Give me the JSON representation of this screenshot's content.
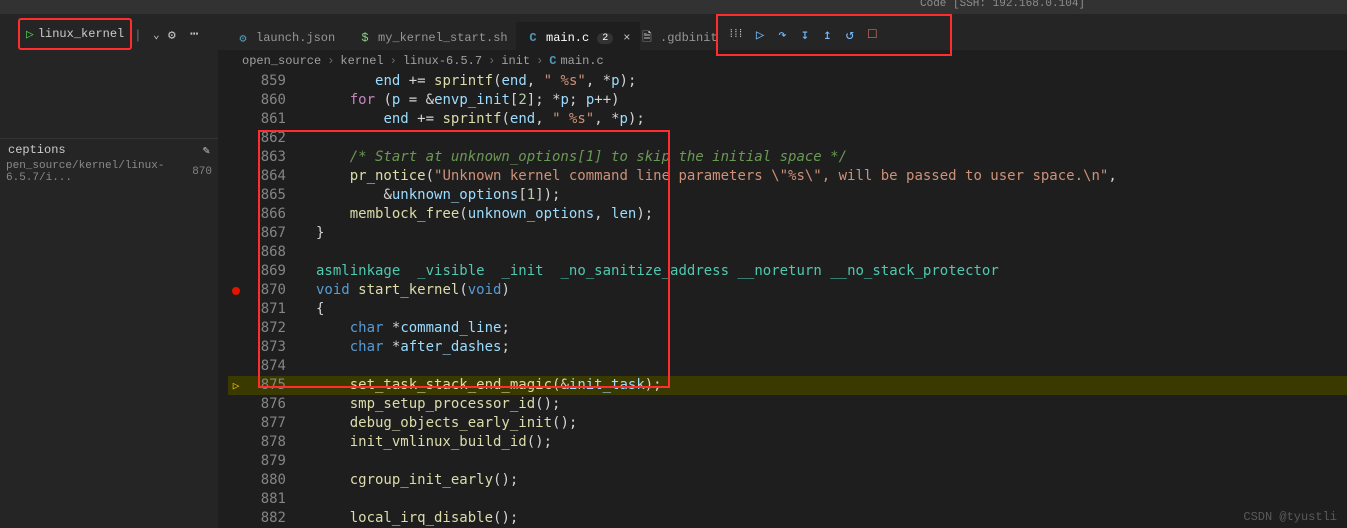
{
  "ssh_hint": "Code [SSH: 192.168.0.104]",
  "toolbar": {
    "config_name": "linux_kernel",
    "tabs": {
      "launch": "launch.json",
      "kern": "my_kernel_start.sh",
      "main": "main.c",
      "main_badge": "2",
      "gdb": ".gdbinit"
    }
  },
  "debug_icons": {
    "grip": "⁞⁞⁞",
    "cont": "▷",
    "over": "↷",
    "into": "↧",
    "out": "↥",
    "restart": "↺",
    "stop": "□"
  },
  "leftpanel": {
    "exceptions": "ceptions",
    "file": "pen_source/kernel/linux-6.5.7/i...",
    "file_line": "870"
  },
  "breadcrumbs": [
    "open_source",
    "kernel",
    "linux-6.5.7",
    "init",
    "main.c"
  ],
  "crumb_icon": "C",
  "lines": [
    {
      "n": "859",
      "g": "",
      "html": "       <span class='var'>end</span> <span class='op'>+=</span> <span class='fn'>sprintf</span>(<span class='var'>end</span>, <span class='str'>\" %s\"</span>, <span class='op'>*</span><span class='var'>p</span>);"
    },
    {
      "n": "860",
      "g": "",
      "html": "    <span class='kw2'>for</span> (<span class='var'>p</span> <span class='op'>=</span> <span class='op'>&amp;</span><span class='var'>envp_init</span>[<span class='num'>2</span>]; <span class='op'>*</span><span class='var'>p</span>; <span class='var'>p</span><span class='op'>++</span>)"
    },
    {
      "n": "861",
      "g": "",
      "html": "        <span class='var'>end</span> <span class='op'>+=</span> <span class='fn'>sprintf</span>(<span class='var'>end</span>, <span class='str'>\" %s\"</span>, <span class='op'>*</span><span class='var'>p</span>);"
    },
    {
      "n": "862",
      "g": "",
      "html": ""
    },
    {
      "n": "863",
      "g": "",
      "html": "    <span class='cm'>/* Start at unknown_options[1] to skip the initial space */</span>"
    },
    {
      "n": "864",
      "g": "",
      "html": "    <span class='fn'>pr_notice</span>(<span class='str'>\"Unknown kernel command line parameters \\\"%s\\\", will be passed to user space.\\n\"</span>,"
    },
    {
      "n": "865",
      "g": "",
      "html": "        <span class='op'>&amp;</span><span class='var'>unknown_options</span>[<span class='num'>1</span>]);"
    },
    {
      "n": "866",
      "g": "",
      "html": "    <span class='fn'>memblock_free</span>(<span class='var'>unknown_options</span>, <span class='var'>len</span>);"
    },
    {
      "n": "867",
      "g": "",
      "html": "}"
    },
    {
      "n": "868",
      "g": "",
      "html": ""
    },
    {
      "n": "869",
      "g": "",
      "html": "<span class='mac'>asmlinkage</span>  <span class='mac'>_visible</span>  <span class='mac'>_init</span>  <span class='mac'>_no_sanitize_address</span> <span class='mac'>__noreturn</span> <span class='mac'>__no_stack_protector</span>"
    },
    {
      "n": "870",
      "g": "bp",
      "html": "<span class='kw'>void</span> <span class='fn'>start_kernel</span>(<span class='kw'>void</span>)"
    },
    {
      "n": "871",
      "g": "",
      "html": "<span class='op'>{</span>"
    },
    {
      "n": "872",
      "g": "",
      "html": "    <span class='kw'>char</span> <span class='op'>*</span><span class='var'>command_line</span>;"
    },
    {
      "n": "873",
      "g": "",
      "html": "    <span class='kw'>char</span> <span class='op'>*</span><span class='var'>after_dashes</span>;"
    },
    {
      "n": "874",
      "g": "",
      "html": ""
    },
    {
      "n": "875",
      "g": "arr",
      "cur": true,
      "html": "    <span class='fn'>set_task_stack_end_magic</span>(<span class='op'>&amp;</span><span class='var'>init_task</span>);"
    },
    {
      "n": "876",
      "g": "",
      "html": "    <span class='fn'>smp_setup_processor_id</span>();"
    },
    {
      "n": "877",
      "g": "",
      "html": "    <span class='fn'>debug_objects_early_init</span>();"
    },
    {
      "n": "878",
      "g": "",
      "html": "    <span class='fn'>init_vmlinux_build_id</span>();"
    },
    {
      "n": "879",
      "g": "",
      "html": ""
    },
    {
      "n": "880",
      "g": "",
      "html": "    <span class='fn'>cgroup_init_early</span>();"
    },
    {
      "n": "881",
      "g": "",
      "html": ""
    },
    {
      "n": "882",
      "g": "",
      "html": "    <span class='fn'>local_irq_disable</span>();"
    }
  ],
  "watermark": "CSDN @tyustli"
}
